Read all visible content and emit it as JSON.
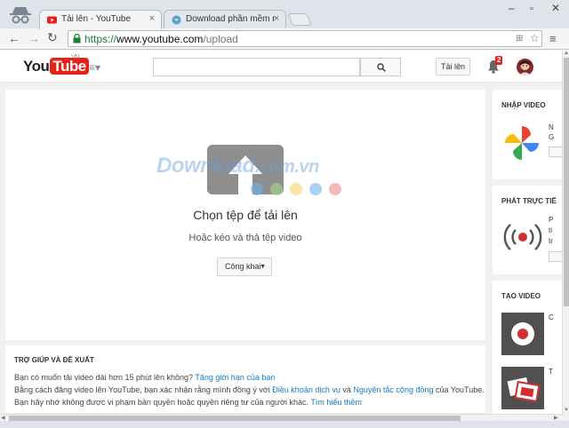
{
  "browser": {
    "tabs": [
      {
        "title": "Tải lên - YouTube",
        "close": "×"
      },
      {
        "title": "Download phần mềm mi",
        "close": "×"
      }
    ],
    "url": {
      "scheme": "https://",
      "host": "www.youtube.com",
      "path": "/upload"
    }
  },
  "youtube": {
    "logo_you": "You",
    "logo_tube": "Tube",
    "logo_region": "VN",
    "search_placeholder": "",
    "upload_label": "Tải lên",
    "notification_count": "2"
  },
  "upload": {
    "title": "Chọn tệp để tải lên",
    "subtitle": "Hoặc kéo và thả tệp video",
    "privacy_label": "Công khai"
  },
  "watermark": {
    "main": "Download",
    "domain": ".com.vn",
    "dot_colors": [
      "#6fb3e6",
      "#a8d98a",
      "#f5d36a",
      "#6fb3e6",
      "#f08a8a"
    ]
  },
  "help": {
    "title": "TRỢ GIÚP VÀ ĐỀ XUẤT",
    "line1_text": "Bạn có muốn tải video dài hơn 15 phút lên không?",
    "line1_link": "Tăng giới hạn của bạn",
    "line2_a": "Bằng cách đăng video lên YouTube, bạn xác nhận rằng mình đồng ý với",
    "line2_link1": "Điều khoản dịch vụ",
    "line2_b": "và",
    "line2_link2": "Nguyên tắc cộng đồng",
    "line2_c": "của YouTube.",
    "line3_text": "Bạn hãy nhớ không được vi phạm bản quyền hoặc quyền riêng tư của người khác.",
    "line3_link": "Tìm hiểu thêm"
  },
  "sidebar": {
    "import_title": "NHẬP VIDEO",
    "import_text1": "N",
    "import_text2": "G",
    "live_title": "PHÁT TRỰC TIẾ",
    "live_text1": "P",
    "live_text2": "ti",
    "live_text3": "tr",
    "create_title": "TẠO VIDEO",
    "create_text1": "C",
    "create_text2": "T"
  },
  "colors": {
    "youtube_red": "#e62117",
    "link_blue": "#167ac6",
    "url_green": "#188038"
  }
}
